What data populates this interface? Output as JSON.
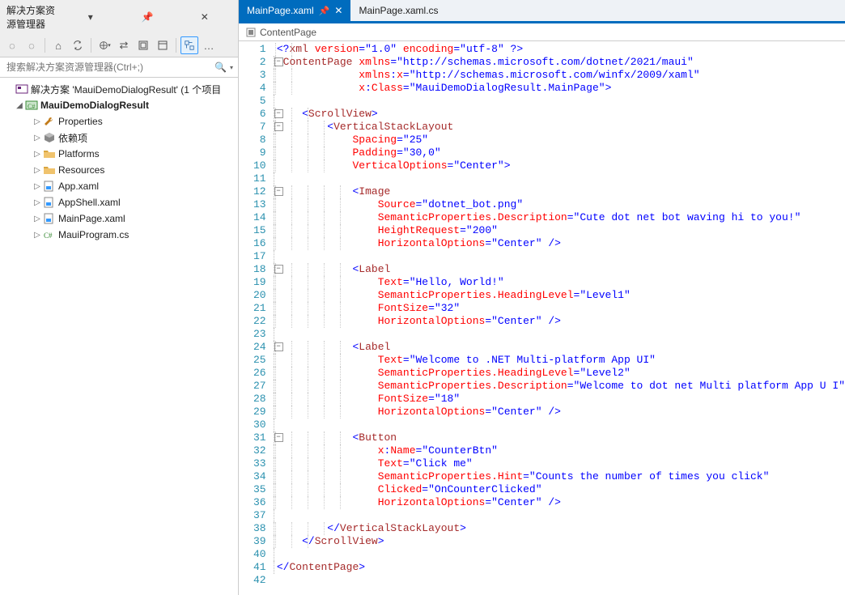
{
  "solutionExplorer": {
    "title": "解决方案资源管理器",
    "searchPlaceholder": "搜索解决方案资源管理器(Ctrl+;)",
    "solutionLabel": "解决方案 'MauiDemoDialogResult' (1 个项目",
    "projectLabel": "MauiDemoDialogResult",
    "items": [
      {
        "label": "Properties",
        "iconColor": "#c27c1a",
        "iconType": "wrench"
      },
      {
        "label": "依赖项",
        "iconColor": "#555",
        "iconType": "pkg"
      },
      {
        "label": "Platforms",
        "iconColor": "#d9a640",
        "iconType": "folder"
      },
      {
        "label": "Resources",
        "iconColor": "#d9a640",
        "iconType": "folder"
      },
      {
        "label": "App.xaml",
        "iconColor": "#3399ff",
        "iconType": "xaml"
      },
      {
        "label": "AppShell.xaml",
        "iconColor": "#3399ff",
        "iconType": "xaml"
      },
      {
        "label": "MainPage.xaml",
        "iconColor": "#3399ff",
        "iconType": "xaml"
      },
      {
        "label": "MauiProgram.cs",
        "iconColor": "#388a34",
        "iconType": "cs"
      }
    ]
  },
  "tabs": {
    "active": {
      "label": "MainPage.xaml"
    },
    "inactive": {
      "label": "MainPage.xaml.cs"
    }
  },
  "crumb": {
    "label": "ContentPage"
  },
  "code": {
    "lineCount": 42,
    "foldBoxes": [
      2,
      6,
      7,
      12,
      18,
      24,
      31
    ],
    "foldLinesFrom": 2,
    "foldLinesTo": 41,
    "guides": {
      "1": 20,
      "2": 20,
      "3": 20,
      "4": 20,
      "6": 40,
      "7": 60,
      "8": 60,
      "9": 60,
      "10": 60,
      "12": 80,
      "13": 80,
      "14": 80,
      "15": 80,
      "16": 80,
      "18": 80,
      "19": 80,
      "20": 80,
      "21": 80,
      "22": 80,
      "24": 80,
      "25": 80,
      "26": 80,
      "27": 80,
      "28": 80,
      "29": 80,
      "31": 80,
      "32": 80,
      "33": 80,
      "34": 80,
      "35": 80,
      "36": 80,
      "38": 60,
      "39": 40
    },
    "lines": [
      {
        "n": 1,
        "html": "<span class='t-blue'>&lt;?</span><span class='t-brown'>xml</span> <span class='t-attr'>version</span><span class='t-blue'>=\"1.0\"</span> <span class='t-attr'>encoding</span><span class='t-blue'>=\"utf-8\" ?&gt;</span>"
      },
      {
        "n": 2,
        "html": "<span class='t-blue'>&lt;</span><span class='t-brown'>ContentPage</span> <span class='t-attr'>xmlns</span><span class='t-blue'>=\"http://schemas.microsoft.com/dotnet/2021/maui\"</span>"
      },
      {
        "n": 3,
        "html": "             <span class='t-attr'>xmlns</span><span class='t-blue'>:</span><span class='t-attr'>x</span><span class='t-blue'>=\"http://schemas.microsoft.com/winfx/2009/xaml\"</span>"
      },
      {
        "n": 4,
        "html": "             <span class='t-attr'>x</span><span class='t-blue'>:</span><span class='t-attr'>Class</span><span class='t-blue'>=\"MauiDemoDialogResult.MainPage\"&gt;</span>"
      },
      {
        "n": 5,
        "html": ""
      },
      {
        "n": 6,
        "html": "    <span class='t-blue'>&lt;</span><span class='t-brown'>ScrollView</span><span class='t-blue'>&gt;</span>"
      },
      {
        "n": 7,
        "html": "        <span class='t-blue'>&lt;</span><span class='t-brown'>VerticalStackLayout</span>"
      },
      {
        "n": 8,
        "html": "            <span class='t-attr'>Spacing</span><span class='t-blue'>=\"25\"</span>"
      },
      {
        "n": 9,
        "html": "            <span class='t-attr'>Padding</span><span class='t-blue'>=\"30,0\"</span>"
      },
      {
        "n": 10,
        "html": "            <span class='t-attr'>VerticalOptions</span><span class='t-blue'>=\"Center\"&gt;</span>"
      },
      {
        "n": 11,
        "html": ""
      },
      {
        "n": 12,
        "html": "            <span class='t-blue'>&lt;</span><span class='t-brown'>Image</span>"
      },
      {
        "n": 13,
        "html": "                <span class='t-attr'>Source</span><span class='t-blue'>=\"dotnet_bot.png\"</span>"
      },
      {
        "n": 14,
        "html": "                <span class='t-attr'>SemanticProperties.Description</span><span class='t-blue'>=\"Cute dot net bot waving hi to you!\"</span>"
      },
      {
        "n": 15,
        "html": "                <span class='t-attr'>HeightRequest</span><span class='t-blue'>=\"200\"</span>"
      },
      {
        "n": 16,
        "html": "                <span class='t-attr'>HorizontalOptions</span><span class='t-blue'>=\"Center\" /&gt;</span>"
      },
      {
        "n": 17,
        "html": ""
      },
      {
        "n": 18,
        "html": "            <span class='t-blue'>&lt;</span><span class='t-brown'>Label</span>"
      },
      {
        "n": 19,
        "html": "                <span class='t-attr'>Text</span><span class='t-blue'>=\"Hello, World!\"</span>"
      },
      {
        "n": 20,
        "html": "                <span class='t-attr'>SemanticProperties.HeadingLevel</span><span class='t-blue'>=\"Level1\"</span>"
      },
      {
        "n": 21,
        "html": "                <span class='t-attr'>FontSize</span><span class='t-blue'>=\"32\"</span>"
      },
      {
        "n": 22,
        "html": "                <span class='t-attr'>HorizontalOptions</span><span class='t-blue'>=\"Center\" /&gt;</span>"
      },
      {
        "n": 23,
        "html": ""
      },
      {
        "n": 24,
        "html": "            <span class='t-blue'>&lt;</span><span class='t-brown'>Label</span>"
      },
      {
        "n": 25,
        "html": "                <span class='t-attr'>Text</span><span class='t-blue'>=\"Welcome to .NET Multi-platform App UI\"</span>"
      },
      {
        "n": 26,
        "html": "                <span class='t-attr'>SemanticProperties.HeadingLevel</span><span class='t-blue'>=\"Level2\"</span>"
      },
      {
        "n": 27,
        "html": "                <span class='t-attr'>SemanticProperties.Description</span><span class='t-blue'>=\"Welcome to dot net Multi platform App U I\"</span>"
      },
      {
        "n": 28,
        "html": "                <span class='t-attr'>FontSize</span><span class='t-blue'>=\"18\"</span>"
      },
      {
        "n": 29,
        "html": "                <span class='t-attr'>HorizontalOptions</span><span class='t-blue'>=\"Center\" /&gt;</span>"
      },
      {
        "n": 30,
        "html": ""
      },
      {
        "n": 31,
        "html": "            <span class='t-blue'>&lt;</span><span class='t-brown'>Button</span>"
      },
      {
        "n": 32,
        "html": "                <span class='t-attr'>x</span><span class='t-blue'>:</span><span class='t-attr'>Name</span><span class='t-blue'>=\"CounterBtn\"</span>"
      },
      {
        "n": 33,
        "html": "                <span class='t-attr'>Text</span><span class='t-blue'>=\"Click me\"</span>"
      },
      {
        "n": 34,
        "html": "                <span class='t-attr'>SemanticProperties.Hint</span><span class='t-blue'>=\"Counts the number of times you click\"</span>"
      },
      {
        "n": 35,
        "html": "                <span class='t-attr'>Clicked</span><span class='t-blue'>=\"OnCounterClicked\"</span>"
      },
      {
        "n": 36,
        "html": "                <span class='t-attr'>HorizontalOptions</span><span class='t-blue'>=\"Center\" /&gt;</span>"
      },
      {
        "n": 37,
        "html": ""
      },
      {
        "n": 38,
        "html": "        <span class='t-blue'>&lt;/</span><span class='t-brown'>VerticalStackLayout</span><span class='t-blue'>&gt;</span>"
      },
      {
        "n": 39,
        "html": "    <span class='t-blue'>&lt;/</span><span class='t-brown'>ScrollView</span><span class='t-blue'>&gt;</span>"
      },
      {
        "n": 40,
        "html": ""
      },
      {
        "n": 41,
        "html": "<span class='t-blue'>&lt;/</span><span class='t-brown'>ContentPage</span><span class='t-blue'>&gt;</span>"
      },
      {
        "n": 42,
        "html": ""
      }
    ]
  }
}
